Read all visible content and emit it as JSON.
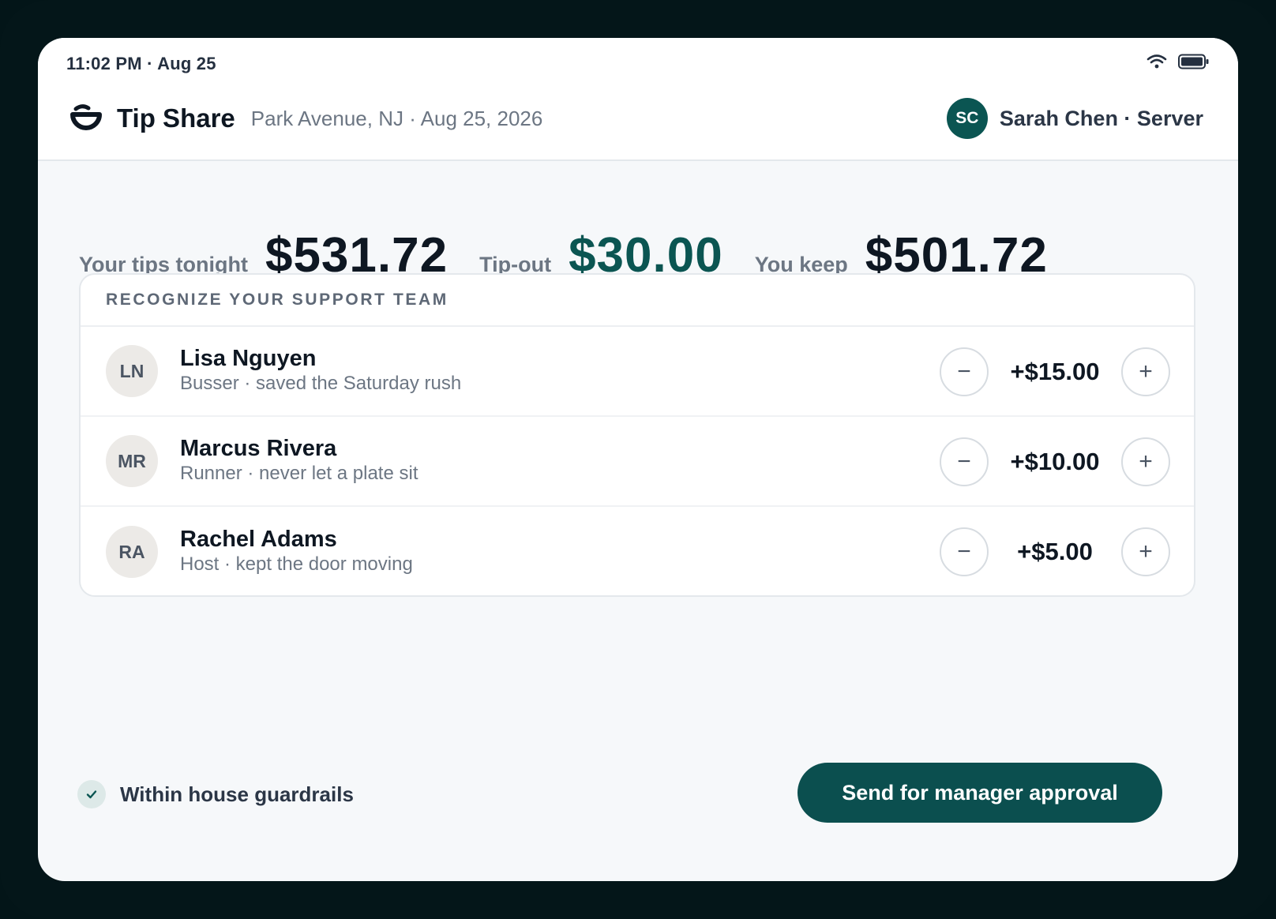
{
  "status": {
    "time": "11:02 PM · Aug 25",
    "wifi_icon": "wifi-icon",
    "battery_icon": "battery-icon"
  },
  "header": {
    "title": "Tip Share",
    "subtitle": "Park Avenue, NJ · Aug 25, 2026",
    "user_initials": "SC",
    "user_label": "Sarah Chen · Server"
  },
  "summary": {
    "tips_label": "Your tips tonight",
    "tips_value": "$531.72",
    "tipout_label": "Tip-out",
    "tipout_value": "$30.00",
    "keep_label": "You keep",
    "keep_value": "$501.72"
  },
  "team": {
    "heading": "RECOGNIZE YOUR SUPPORT TEAM",
    "members": [
      {
        "initials": "LN",
        "name": "Lisa Nguyen",
        "role": "Busser · saved the Saturday rush",
        "amount": "+$15.00",
        "minus": "−",
        "plus": "+"
      },
      {
        "initials": "MR",
        "name": "Marcus Rivera",
        "role": "Runner · never let a plate sit",
        "amount": "+$10.00",
        "minus": "−",
        "plus": "+"
      },
      {
        "initials": "RA",
        "name": "Rachel Adams",
        "role": "Host · kept the door moving",
        "amount": "+$5.00",
        "minus": "−",
        "plus": "+"
      }
    ]
  },
  "footer": {
    "guardrail_text": "Within house guardrails",
    "submit_label": "Send for manager approval"
  },
  "colors": {
    "accent": "#0b5552",
    "button": "#0b4f4f",
    "bezel": "#041619"
  }
}
